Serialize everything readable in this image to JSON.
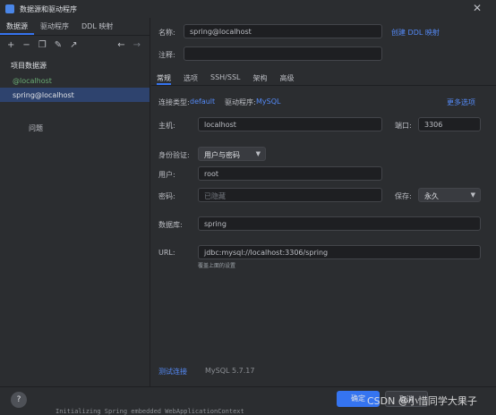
{
  "window": {
    "title": "数据源和驱动程序"
  },
  "left": {
    "tabs": [
      "数据源",
      "驱动程序",
      "DDL 映射"
    ],
    "section_title": "项目数据源",
    "items": [
      "@localhost",
      "spring@localhost"
    ],
    "problems_label": "问题"
  },
  "right": {
    "name_label": "名称:",
    "name_value": "spring@localhost",
    "create_ddl_link": "创建 DDL 映射",
    "comment_label": "注释:",
    "tabs": [
      "常规",
      "选项",
      "SSH/SSL",
      "架构",
      "高级"
    ],
    "conn_type_label": "连接类型:",
    "conn_type_value": "default",
    "driver_label": "驱动程序:",
    "driver_value": "MySQL",
    "more_options": "更多选项",
    "host_label": "主机:",
    "host_value": "localhost",
    "port_label": "端口:",
    "port_value": "3306",
    "auth_label": "身份验证:",
    "auth_value": "用户与密码",
    "user_label": "用户:",
    "user_value": "root",
    "password_label": "密码:",
    "password_placeholder": "已隐藏",
    "save_label": "保存:",
    "save_value": "永久",
    "database_label": "数据库:",
    "database_value": "spring",
    "url_label": "URL:",
    "url_value": "jdbc:mysql://localhost:3306/spring",
    "url_hint": "覆盖上面的设置",
    "test_link": "测试连接",
    "version": "MySQL 5.7.17"
  },
  "bottom": {
    "help": "?",
    "ok": "确定",
    "cancel": "取消",
    "watermark": "CSDN @小惜同学大果子"
  },
  "console_line": "Initializing Spring embedded WebApplicationContext"
}
